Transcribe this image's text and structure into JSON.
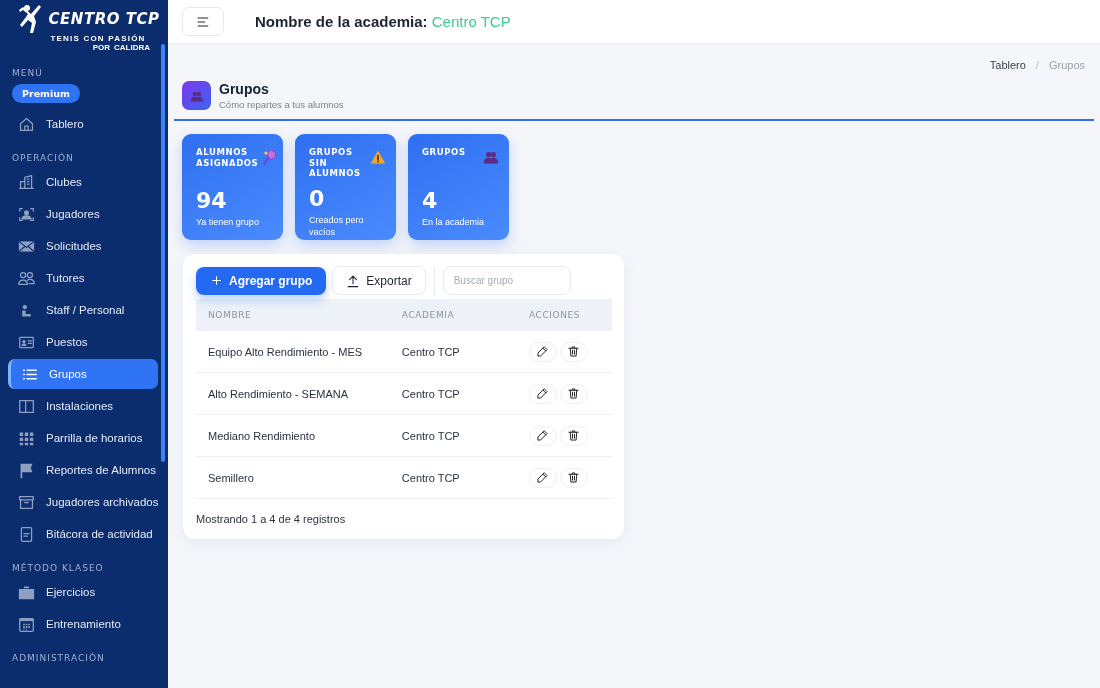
{
  "logo": {
    "title": "CENTRO TCP",
    "tagline": "TENIS CON PASIÓN",
    "by": "POR",
    "brand": "CALIDRA"
  },
  "sidebar": {
    "sections": [
      {
        "title": "MENÚ",
        "badge": "Premium",
        "items": [
          {
            "label": "Tablero",
            "selected": false
          }
        ]
      },
      {
        "title": "OPERACIÓN",
        "items": [
          {
            "label": "Clubes",
            "selected": false
          },
          {
            "label": "Jugadores",
            "selected": false
          },
          {
            "label": "Solicitudes",
            "selected": false
          },
          {
            "label": "Tutores",
            "selected": false
          },
          {
            "label": "Staff / Personal",
            "selected": false
          },
          {
            "label": "Puestos",
            "selected": false
          },
          {
            "label": "Grupos",
            "selected": true
          },
          {
            "label": "Instalaciones",
            "selected": false
          },
          {
            "label": "Parrilla de horarios",
            "selected": false
          },
          {
            "label": "Reportes de Alumnos",
            "selected": false
          },
          {
            "label": "Jugadores archivados",
            "selected": false
          },
          {
            "label": "Bitácora de actividad",
            "selected": false
          }
        ]
      },
      {
        "title": "MÉTODO KLASEO",
        "items": [
          {
            "label": "Ejercicios",
            "selected": false
          },
          {
            "label": "Entrenamiento",
            "selected": false
          }
        ]
      },
      {
        "title": "ADMINISTRACIÓN"
      }
    ]
  },
  "header": {
    "label": "Nombre de la academia:",
    "academy": "Centro TCP"
  },
  "breadcrumb": {
    "separator": "/",
    "items": [
      {
        "label": "Tablero",
        "current": false
      },
      {
        "label": "Grupos",
        "current": true
      }
    ]
  },
  "page": {
    "title": "Grupos",
    "subtitle": "Cómo repartes a tus alumnos"
  },
  "stats": [
    {
      "title": "ALUMNOS ASIGNADOS",
      "value": "94",
      "caption": "Ya tienen grupo"
    },
    {
      "title": "GRUPOS SIN ALUMNOS",
      "value": "0",
      "caption": "Creados pero vacíos"
    },
    {
      "title": "GRUPOS",
      "value": "4",
      "caption": "En la academia"
    }
  ],
  "toolbar": {
    "add": "Agregar grupo",
    "export": "Exportar",
    "search_placeholder": "Buscar grupo"
  },
  "table": {
    "columns": [
      "NOMBRE",
      "ACADEMIA",
      "ACCIONES"
    ],
    "rows": [
      {
        "name": "Equipo Alto Rendimiento - MES",
        "academy": "Centro TCP"
      },
      {
        "name": "Alto Rendimiento - SEMANA",
        "academy": "Centro TCP"
      },
      {
        "name": "Mediano Rendimiento",
        "academy": "Centro TCP"
      },
      {
        "name": "Semillero",
        "academy": "Centro TCP"
      }
    ]
  },
  "footer": "Mostrando 1 a 4 de 4 registros"
}
